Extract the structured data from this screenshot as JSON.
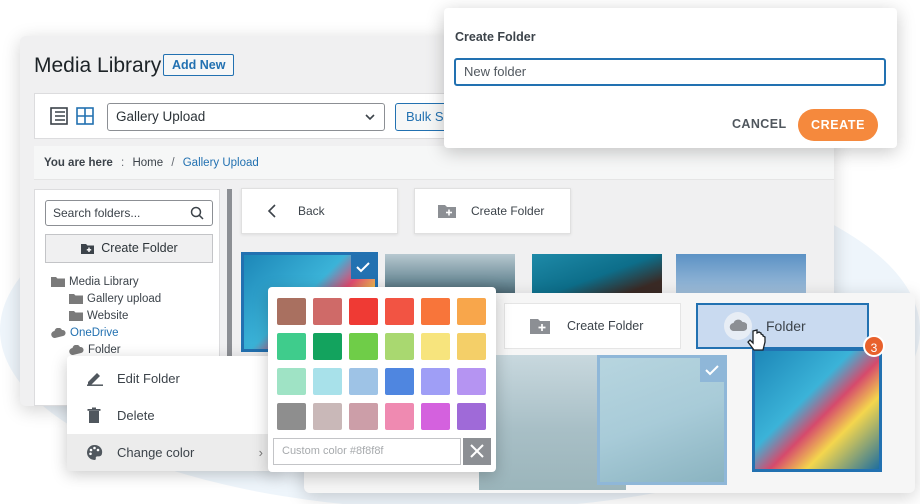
{
  "page": {
    "title": "Media Library",
    "add_new_label": "Add New"
  },
  "toolbar": {
    "folder_select_value": "Gallery Upload",
    "bulk_select_label": "Bulk Se"
  },
  "breadcrumb": {
    "lead": "You are here",
    "separator": ":",
    "home": "Home",
    "divider": "/",
    "current": "Gallery Upload"
  },
  "sidebar": {
    "search_placeholder": "Search folders...",
    "create_folder_label": "Create Folder",
    "tree": [
      {
        "label": "Media Library",
        "level": 0
      },
      {
        "label": "Gallery upload",
        "level": 1
      },
      {
        "label": "Website",
        "level": 1
      },
      {
        "label": "OneDrive",
        "level": 0
      },
      {
        "label": "Folder",
        "level": 1
      }
    ]
  },
  "content": {
    "back_label": "Back",
    "create_folder_label": "Create Folder"
  },
  "context_menu": {
    "edit_label": "Edit Folder",
    "delete_label": "Delete",
    "change_color_label": "Change color",
    "arrow": "›"
  },
  "color_picker": {
    "swatches": [
      "#a97060",
      "#cf6a68",
      "#ef3a34",
      "#f25443",
      "#f8753a",
      "#f8a64b",
      "#3fcc8c",
      "#13a35e",
      "#6fcd48",
      "#a9d870",
      "#f7e47d",
      "#f4cf68",
      "#9fe3c5",
      "#a8e1ea",
      "#9ec3e6",
      "#4f86e0",
      "#9f9ef6",
      "#b594f2",
      "#8e8e8e",
      "#c9b8b8",
      "#cc9ea8",
      "#ef8ab1",
      "#d461de",
      "#9f6ad8"
    ],
    "custom_placeholder": "Custom color #8f8f8f"
  },
  "grid_overlay": {
    "create_folder_label": "Create Folder",
    "folder_label": "Folder",
    "badge_count": "3"
  },
  "dialog": {
    "title": "Create Folder",
    "input_value": "New folder",
    "cancel_label": "CANCEL",
    "create_label": "CREATE"
  },
  "colors": {
    "accent": "#2271b1",
    "create_button": "#f5893d",
    "badge": "#e8612c"
  }
}
